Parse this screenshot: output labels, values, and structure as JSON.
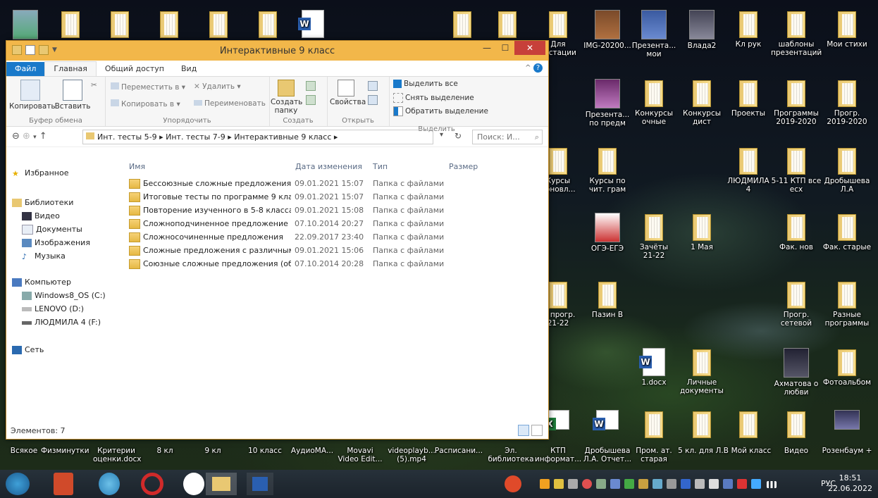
{
  "window": {
    "title": "Интерактивные 9 класс",
    "tabs": [
      "Файл",
      "Главная",
      "Общий доступ",
      "Вид"
    ],
    "ribbon": {
      "clipboard": {
        "copy": "Копировать",
        "paste": "Вставить",
        "label": "Буфер обмена"
      },
      "organize": {
        "move": "Переместить в",
        "copy_to": "Копировать в",
        "delete": "Удалить",
        "rename": "Переименовать",
        "label": "Упорядочить"
      },
      "create": {
        "new_folder_1": "Создать",
        "new_folder_2": "папку",
        "label": "Создать"
      },
      "open": {
        "properties": "Свойства",
        "label": "Открыть"
      },
      "select": {
        "select_all": "Выделить все",
        "select_none": "Снять выделение",
        "invert": "Обратить выделение",
        "label": "Выделить"
      }
    },
    "address": {
      "path": "Инт. тесты 5-9 ▸ Инт. тесты 7-9 ▸ Интерактивные 9 класс ▸",
      "search_placeholder": "Поиск: И..."
    },
    "nav": {
      "favorites": "Избранное",
      "libraries": "Библиотеки",
      "video": "Видео",
      "documents": "Документы",
      "images": "Изображения",
      "music": "Музыка",
      "computer": "Компьютер",
      "drive_c": "Windows8_OS (C:)",
      "drive_d": "LENOVO (D:)",
      "drive_f": "ЛЮДМИЛА 4 (F:)",
      "network": "Сеть"
    },
    "columns": {
      "name": "Имя",
      "date": "Дата изменения",
      "type": "Тип",
      "size": "Размер"
    },
    "files": [
      {
        "name": "Бессоюзные сложные предложения",
        "date": "09.01.2021 15:07",
        "type": "Папка с файлами"
      },
      {
        "name": "Итоговые тесты по программе 9 класса",
        "date": "09.01.2021 15:07",
        "type": "Папка с файлами"
      },
      {
        "name": "Повторение изученного в 5-8 классах",
        "date": "09.01.2021 15:08",
        "type": "Папка с файлами"
      },
      {
        "name": "Сложноподчиненное предложение",
        "date": "07.10.2014 20:27",
        "type": "Папка с файлами"
      },
      {
        "name": "Сложносочиненные предложения",
        "date": "22.09.2017 23:40",
        "type": "Папка с файлами"
      },
      {
        "name": "Сложные предложения с различными ...",
        "date": "09.01.2021 15:06",
        "type": "Папка с файлами"
      },
      {
        "name": "Союзные сложные предложения (обо...",
        "date": "07.10.2014 20:28",
        "type": "Папка с файлами"
      }
    ],
    "status": "Элементов: 7"
  },
  "desktop": {
    "right": [
      {
        "l1": "Для",
        "l2": "тестации"
      },
      {
        "l1": "IMG-20200...",
        "l2": ""
      },
      {
        "l1": "Презента...",
        "l2": "мои"
      },
      {
        "l1": "Влада2",
        "l2": ""
      },
      {
        "l1": "Кл рук",
        "l2": ""
      },
      {
        "l1": "шаблоны",
        "l2": "презентаций"
      },
      {
        "l1": "Мои стихи",
        "l2": ""
      },
      {
        "l1": "Презента...",
        "l2": "по предм"
      },
      {
        "l1": "Конкурсы",
        "l2": "очные"
      },
      {
        "l1": "Конкурсы",
        "l2": "дист"
      },
      {
        "l1": "Проекты",
        "l2": ""
      },
      {
        "l1": "Программы",
        "l2": "2019-2020"
      },
      {
        "l1": "Прогр.",
        "l2": "2019-2020"
      },
      {
        "l1": "Курсы",
        "l2": "обновл..."
      },
      {
        "l1": "Курсы по",
        "l2": "чит. грам"
      },
      {
        "l1": "ЛЮДМИЛА",
        "l2": "4"
      },
      {
        "l1": "5-11 КТП все",
        "l2": "есх"
      },
      {
        "l1": "Дробышева",
        "l2": "Л.А"
      },
      {
        "l1": "ОГЭ-ЕГЭ",
        "l2": ""
      },
      {
        "l1": "Зачёты",
        "l2": "21-22"
      },
      {
        "l1": "1 Мая",
        "l2": ""
      },
      {
        "l1": "Фак. нов",
        "l2": ""
      },
      {
        "l1": "Фак. старые",
        "l2": ""
      },
      {
        "l1": "б. прогр.",
        "l2": "21-22"
      },
      {
        "l1": "Пазин В",
        "l2": ""
      },
      {
        "l1": "Прогр.",
        "l2": "сетевой"
      },
      {
        "l1": "Разные",
        "l2": "программы"
      },
      {
        "l1": "1.docx",
        "l2": ""
      },
      {
        "l1": "Личные",
        "l2": "документы"
      },
      {
        "l1": "Ахматова о",
        "l2": "любви"
      },
      {
        "l1": "Фотоальбом",
        "l2": ""
      }
    ],
    "bottom": [
      {
        "l1": "Всякое",
        "l2": ""
      },
      {
        "l1": "Физминутки",
        "l2": ""
      },
      {
        "l1": "Критерии",
        "l2": "оценки.docx"
      },
      {
        "l1": "8 кл",
        "l2": ""
      },
      {
        "l1": "9 кл",
        "l2": ""
      },
      {
        "l1": "10 класс",
        "l2": ""
      },
      {
        "l1": "АудиоМА...",
        "l2": ""
      },
      {
        "l1": "Movavi",
        "l2": "Video Edit..."
      },
      {
        "l1": "videoplayb...",
        "l2": "(5).mp4"
      },
      {
        "l1": "Расписани...",
        "l2": ""
      },
      {
        "l1": "Эл.",
        "l2": "библиотека"
      },
      {
        "l1": "КТП",
        "l2": "информат..."
      },
      {
        "l1": "Дробышева",
        "l2": "Л.А. Отчет..."
      },
      {
        "l1": "Пром. ат.",
        "l2": "старая"
      },
      {
        "l1": "5 кл. для Л.В",
        "l2": ""
      },
      {
        "l1": "Мой класс",
        "l2": ""
      },
      {
        "l1": "Видео",
        "l2": ""
      },
      {
        "l1": "Розенбаум +",
        "l2": ""
      }
    ]
  },
  "taskbar": {
    "lang": "РУС",
    "time": "18:51",
    "date": "22.06.2022"
  }
}
